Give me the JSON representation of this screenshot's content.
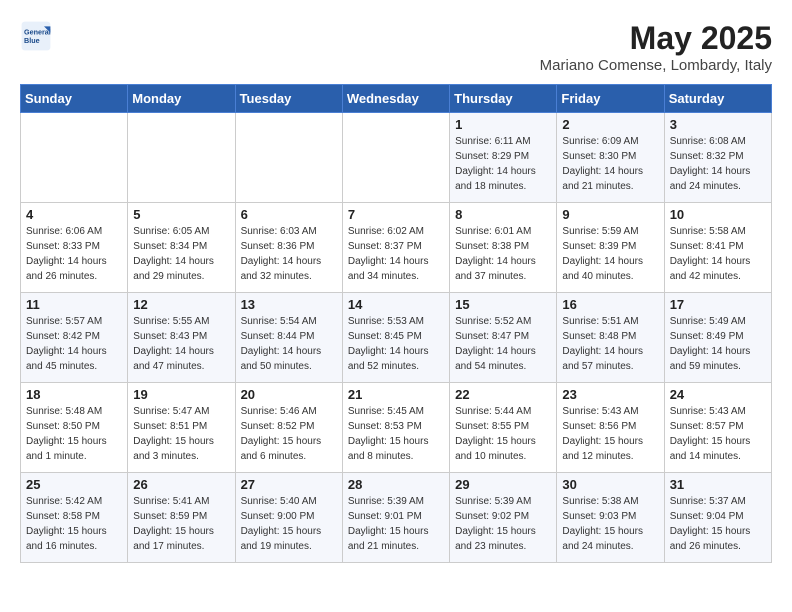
{
  "header": {
    "logo_line1": "General",
    "logo_line2": "Blue",
    "month": "May 2025",
    "location": "Mariano Comense, Lombardy, Italy"
  },
  "weekdays": [
    "Sunday",
    "Monday",
    "Tuesday",
    "Wednesday",
    "Thursday",
    "Friday",
    "Saturday"
  ],
  "weeks": [
    [
      {
        "day": "",
        "info": ""
      },
      {
        "day": "",
        "info": ""
      },
      {
        "day": "",
        "info": ""
      },
      {
        "day": "",
        "info": ""
      },
      {
        "day": "1",
        "info": "Sunrise: 6:11 AM\nSunset: 8:29 PM\nDaylight: 14 hours\nand 18 minutes."
      },
      {
        "day": "2",
        "info": "Sunrise: 6:09 AM\nSunset: 8:30 PM\nDaylight: 14 hours\nand 21 minutes."
      },
      {
        "day": "3",
        "info": "Sunrise: 6:08 AM\nSunset: 8:32 PM\nDaylight: 14 hours\nand 24 minutes."
      }
    ],
    [
      {
        "day": "4",
        "info": "Sunrise: 6:06 AM\nSunset: 8:33 PM\nDaylight: 14 hours\nand 26 minutes."
      },
      {
        "day": "5",
        "info": "Sunrise: 6:05 AM\nSunset: 8:34 PM\nDaylight: 14 hours\nand 29 minutes."
      },
      {
        "day": "6",
        "info": "Sunrise: 6:03 AM\nSunset: 8:36 PM\nDaylight: 14 hours\nand 32 minutes."
      },
      {
        "day": "7",
        "info": "Sunrise: 6:02 AM\nSunset: 8:37 PM\nDaylight: 14 hours\nand 34 minutes."
      },
      {
        "day": "8",
        "info": "Sunrise: 6:01 AM\nSunset: 8:38 PM\nDaylight: 14 hours\nand 37 minutes."
      },
      {
        "day": "9",
        "info": "Sunrise: 5:59 AM\nSunset: 8:39 PM\nDaylight: 14 hours\nand 40 minutes."
      },
      {
        "day": "10",
        "info": "Sunrise: 5:58 AM\nSunset: 8:41 PM\nDaylight: 14 hours\nand 42 minutes."
      }
    ],
    [
      {
        "day": "11",
        "info": "Sunrise: 5:57 AM\nSunset: 8:42 PM\nDaylight: 14 hours\nand 45 minutes."
      },
      {
        "day": "12",
        "info": "Sunrise: 5:55 AM\nSunset: 8:43 PM\nDaylight: 14 hours\nand 47 minutes."
      },
      {
        "day": "13",
        "info": "Sunrise: 5:54 AM\nSunset: 8:44 PM\nDaylight: 14 hours\nand 50 minutes."
      },
      {
        "day": "14",
        "info": "Sunrise: 5:53 AM\nSunset: 8:45 PM\nDaylight: 14 hours\nand 52 minutes."
      },
      {
        "day": "15",
        "info": "Sunrise: 5:52 AM\nSunset: 8:47 PM\nDaylight: 14 hours\nand 54 minutes."
      },
      {
        "day": "16",
        "info": "Sunrise: 5:51 AM\nSunset: 8:48 PM\nDaylight: 14 hours\nand 57 minutes."
      },
      {
        "day": "17",
        "info": "Sunrise: 5:49 AM\nSunset: 8:49 PM\nDaylight: 14 hours\nand 59 minutes."
      }
    ],
    [
      {
        "day": "18",
        "info": "Sunrise: 5:48 AM\nSunset: 8:50 PM\nDaylight: 15 hours\nand 1 minute."
      },
      {
        "day": "19",
        "info": "Sunrise: 5:47 AM\nSunset: 8:51 PM\nDaylight: 15 hours\nand 3 minutes."
      },
      {
        "day": "20",
        "info": "Sunrise: 5:46 AM\nSunset: 8:52 PM\nDaylight: 15 hours\nand 6 minutes."
      },
      {
        "day": "21",
        "info": "Sunrise: 5:45 AM\nSunset: 8:53 PM\nDaylight: 15 hours\nand 8 minutes."
      },
      {
        "day": "22",
        "info": "Sunrise: 5:44 AM\nSunset: 8:55 PM\nDaylight: 15 hours\nand 10 minutes."
      },
      {
        "day": "23",
        "info": "Sunrise: 5:43 AM\nSunset: 8:56 PM\nDaylight: 15 hours\nand 12 minutes."
      },
      {
        "day": "24",
        "info": "Sunrise: 5:43 AM\nSunset: 8:57 PM\nDaylight: 15 hours\nand 14 minutes."
      }
    ],
    [
      {
        "day": "25",
        "info": "Sunrise: 5:42 AM\nSunset: 8:58 PM\nDaylight: 15 hours\nand 16 minutes."
      },
      {
        "day": "26",
        "info": "Sunrise: 5:41 AM\nSunset: 8:59 PM\nDaylight: 15 hours\nand 17 minutes."
      },
      {
        "day": "27",
        "info": "Sunrise: 5:40 AM\nSunset: 9:00 PM\nDaylight: 15 hours\nand 19 minutes."
      },
      {
        "day": "28",
        "info": "Sunrise: 5:39 AM\nSunset: 9:01 PM\nDaylight: 15 hours\nand 21 minutes."
      },
      {
        "day": "29",
        "info": "Sunrise: 5:39 AM\nSunset: 9:02 PM\nDaylight: 15 hours\nand 23 minutes."
      },
      {
        "day": "30",
        "info": "Sunrise: 5:38 AM\nSunset: 9:03 PM\nDaylight: 15 hours\nand 24 minutes."
      },
      {
        "day": "31",
        "info": "Sunrise: 5:37 AM\nSunset: 9:04 PM\nDaylight: 15 hours\nand 26 minutes."
      }
    ]
  ]
}
